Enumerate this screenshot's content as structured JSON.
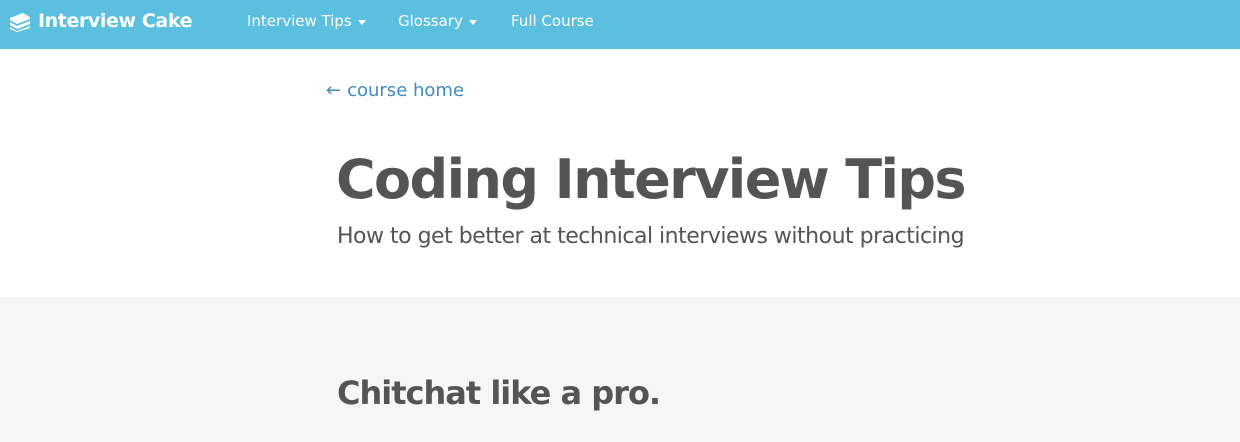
{
  "navbar": {
    "brand": "Interview Cake",
    "items": [
      {
        "label": "Interview Tips",
        "has_dropdown": true
      },
      {
        "label": "Glossary",
        "has_dropdown": true
      },
      {
        "label": "Full Course",
        "has_dropdown": false
      }
    ],
    "background_color": "#5bbfdf"
  },
  "back_link": {
    "arrow": "←",
    "label": "course home"
  },
  "header": {
    "title": "Coding Interview Tips",
    "subtitle": "How to get better at technical interviews without practicing"
  },
  "content": {
    "section_heading": "Chitchat like a pro."
  },
  "colors": {
    "link": "#3e8bc0",
    "text": "#545454",
    "content_background": "#f6f6f6"
  },
  "icons": {
    "brand": "cake-icon",
    "dropdown": "caret-down-icon"
  }
}
